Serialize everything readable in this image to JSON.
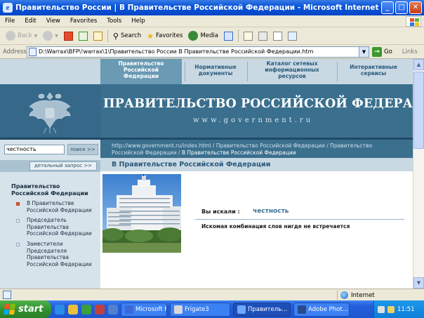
{
  "window": {
    "title": "Правительство России | В Правительстве Российской Федерации - Microsoft Internet Explorer - [Working ..."
  },
  "menu": [
    "File",
    "Edit",
    "View",
    "Favorites",
    "Tools",
    "Help"
  ],
  "toolbar": {
    "back": "Back",
    "search": "Search",
    "favorites": "Favorites",
    "media": "Media"
  },
  "address": {
    "label": "Address",
    "url": "D:\\Warrax\\BFP\\!warrax\\1\\Правительство России  В Правительстве Российской Федерации.htm",
    "go": "Go",
    "links": "Links"
  },
  "site": {
    "nav": [
      "Правительство Российской Федерации",
      "Нормативные документы",
      "Каталог сетевых информационных ресурсов",
      "Интерактивные сервисы"
    ],
    "banner_title": "ПРАВИТЕЛЬСТВО РОССИЙСКОЙ ФЕДЕРАЦИИ",
    "banner_url": "www.government.ru",
    "search_value": "честность",
    "search_button": "поиск >>",
    "advanced_button": "детальный запрос >>",
    "left_menu_title": "Правительство Российской Федерации",
    "left_menu": [
      "В Правительстве Российской Федерации",
      "Председатель Правительства Российской Федерации",
      "Заместители Председателя Правительства Российской Федерации"
    ],
    "breadcrumb_path": "http://www.government.ru/index.html / Правительство Российской Федерации / Правительство Российской Федерации / ",
    "breadcrumb_current": "В Правительстве Российской Федерации",
    "page_title": "В Правительстве Российской Федерации",
    "searched_label": "Вы искали :",
    "searched_value": "честность",
    "result_message": "Искомая комбинация слов нигде не встречается"
  },
  "status": {
    "zone": "Internet"
  },
  "taskbar": {
    "start": "start",
    "tasks": [
      "Microsoft Fr...",
      "Frigate3",
      "Правитель...",
      "Adobe Phot..."
    ],
    "clock": "11:51"
  },
  "colors": {
    "banner": "#3b6f8e",
    "nav_active": "#6a9ab4",
    "xp_blue": "#245edb",
    "start_green": "#2f8f2c"
  }
}
